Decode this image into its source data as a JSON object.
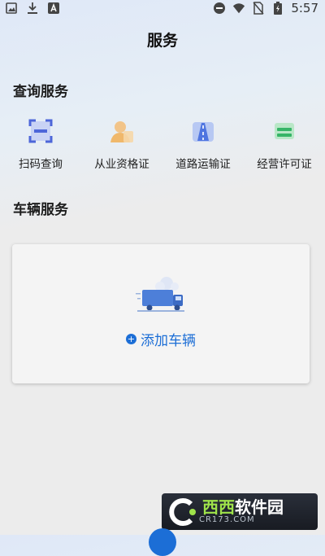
{
  "statusbar": {
    "time": "5:57",
    "left_icons": [
      "image-icon",
      "download-icon",
      "text-a-icon"
    ],
    "right_icons": [
      "do-not-disturb-icon",
      "wifi-icon",
      "no-sim-icon",
      "battery-charging-icon"
    ]
  },
  "page": {
    "title": "服务"
  },
  "query_section": {
    "title": "查询服务",
    "items": [
      {
        "label": "扫码查询",
        "icon": "scan-icon"
      },
      {
        "label": "从业资格证",
        "icon": "person-icon"
      },
      {
        "label": "道路运输证",
        "icon": "road-icon"
      },
      {
        "label": "经营许可证",
        "icon": "license-icon"
      }
    ]
  },
  "vehicle_section": {
    "title": "车辆服务",
    "add_label": "添加车辆"
  },
  "watermark": {
    "main_a": "西西",
    "main_b": "软件园",
    "sub": "CR173.COM"
  },
  "colors": {
    "accent": "#1c6ed6",
    "background": "#ececec"
  }
}
